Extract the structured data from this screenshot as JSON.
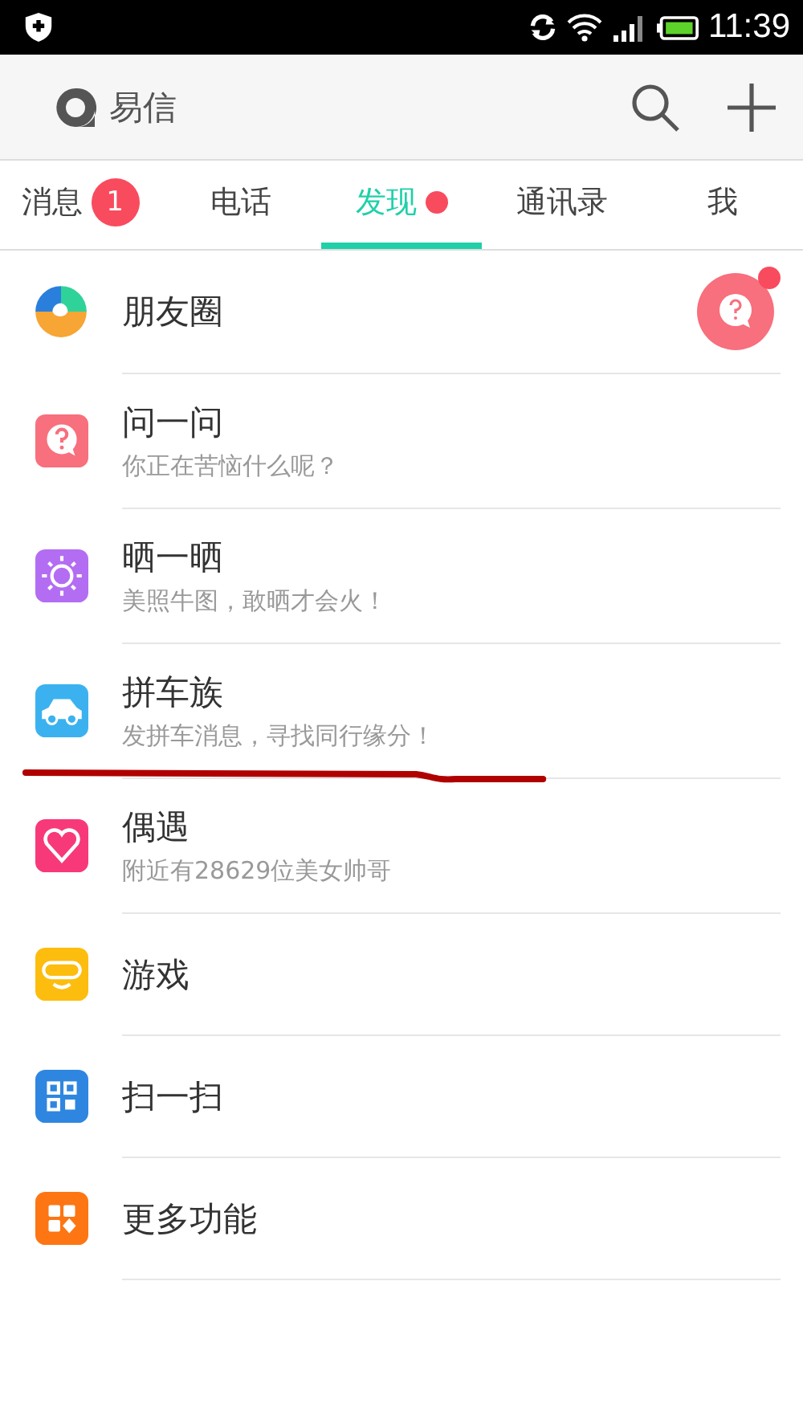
{
  "status_bar": {
    "time": "11:39"
  },
  "header": {
    "title": "易信"
  },
  "tabs": [
    {
      "label": "消息",
      "selected": false,
      "badge": "1",
      "dot": false
    },
    {
      "label": "电话",
      "selected": false,
      "dot": false
    },
    {
      "label": "发现",
      "selected": true,
      "dot": true
    },
    {
      "label": "通讯录",
      "selected": false,
      "dot": false
    },
    {
      "label": "我",
      "selected": false,
      "dot": false
    }
  ],
  "items": [
    {
      "title": "朋友圈",
      "kind": "feed",
      "new_dot": true,
      "underlined": false
    },
    {
      "title": "问一问",
      "subtitle": "你正在苦恼什么呢？",
      "kind": "plain",
      "underlined": false
    },
    {
      "title": "晒一晒",
      "subtitle": "美照牛图，敢晒才会火！",
      "kind": "plain",
      "underlined": false
    },
    {
      "title": "拼车族",
      "subtitle": "发拼车消息，寻找同行缘分！",
      "kind": "plain",
      "underlined": true
    },
    {
      "title": "偶遇",
      "subtitle": "附近有28629位美女帅哥",
      "kind": "plain",
      "underlined": false
    },
    {
      "title": "游戏",
      "kind": "plain",
      "underlined": false
    },
    {
      "title": "扫一扫",
      "kind": "plain",
      "underlined": false
    },
    {
      "title": "更多功能",
      "kind": "plain",
      "underlined": false
    }
  ]
}
